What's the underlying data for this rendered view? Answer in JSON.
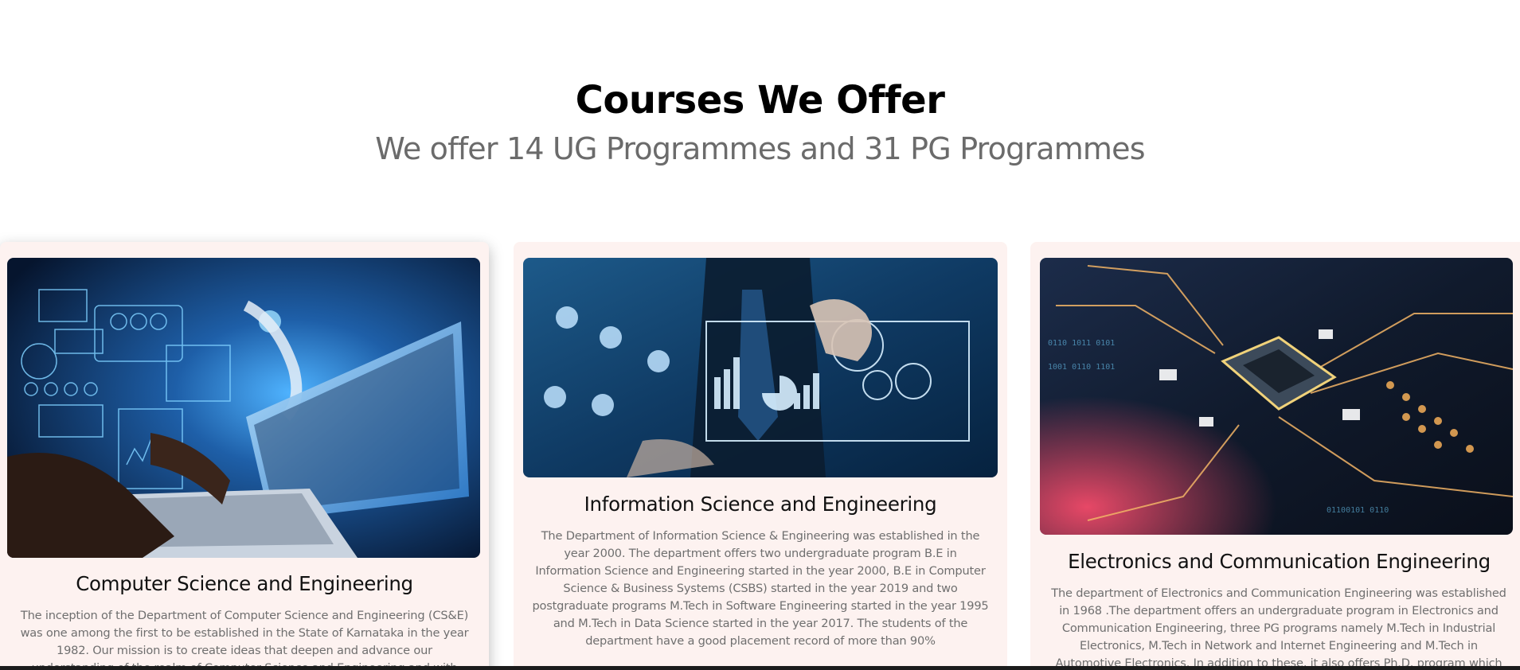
{
  "section": {
    "title": "Courses We Offer",
    "subtitle": "We offer 14 UG Programmes and 31 PG Programmes"
  },
  "courses": [
    {
      "title": "Computer Science and Engineering",
      "image_icon": "laptop-ai-illustration",
      "description": "The inception of the Department of Computer Science and Engineering (CS&E) was one among the first to be established in the State of Karnataka in the year 1982. Our mission is to create ideas that deepen and advance our understanding of the realm of Computer Science and Engineering and with these ideas to"
    },
    {
      "title": "Information Science and Engineering",
      "image_icon": "business-analytics-illustration",
      "description": "The Department of Information Science & Engineering was established in the year 2000. The department offers two undergraduate program B.E in Information Science and Engineering started in the year 2000, B.E in Computer Science & Business Systems (CSBS) started in the year 2019 and two postgraduate programs M.Tech in Software Engineering started in the year 1995 and M.Tech in Data Science started in the year 2017. The students of the department have a good placement record of more than 90%"
    },
    {
      "title": "Electronics and Communication Engineering",
      "image_icon": "circuit-board-chip-illustration",
      "description": "The department of Electronics and Communication Engineering was established in 1968 .The department offers an undergraduate program in Electronics and Communication Engineering, three PG programs namely M.Tech in Industrial Electronics, M.Tech in Network and Internet Engineering and M.Tech in Automotive Electronics. In addition to these, it also offers Ph.D. program which provide a"
    }
  ],
  "colors": {
    "card_background": "#fdf2f0",
    "heading": "#000000",
    "subheading": "#6b6b6b",
    "description": "#6f6f6f"
  }
}
